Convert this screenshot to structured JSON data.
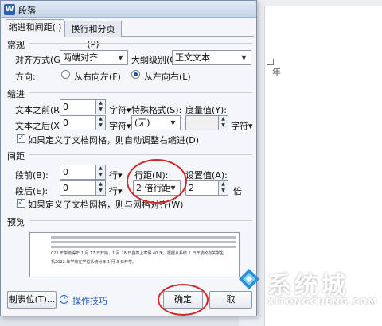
{
  "dialog": {
    "title": "段落",
    "app_icon": "W"
  },
  "tabs": [
    {
      "label": "缩进和间距(I)",
      "active": true
    },
    {
      "label": "换行和分页(P)",
      "active": false
    }
  ],
  "general": {
    "heading": "常规",
    "alignment_label": "对齐方式(G):",
    "alignment_value": "两端对齐",
    "outline_label": "大纲级别(O):",
    "outline_value": "正文文本",
    "direction_label": "方向:",
    "rtl_label": "从右向左(F)",
    "ltr_label": "从左向右(L)",
    "direction_selected": "ltr"
  },
  "indent": {
    "heading": "缩进",
    "before_label": "文本之前(R):",
    "before_value": "0",
    "before_unit": "字符▾",
    "after_label": "文本之后(X):",
    "after_value": "0",
    "after_unit": "字符▾",
    "special_label": "特殊格式(S):",
    "special_value": "(无)",
    "measure_label": "度量值(Y):",
    "measure_value": "",
    "measure_unit": "字符▾",
    "auto_adjust_label": "如果定义了文档网格，则自动调整右缩进(D)",
    "auto_adjust_checked": true
  },
  "spacing": {
    "heading": "间距",
    "before_label": "段前(B):",
    "before_value": "0",
    "before_unit": "行▾",
    "after_label": "段后(E):",
    "after_value": "0",
    "after_unit": "行▾",
    "line_label": "行距(N):",
    "line_value": "2 倍行距",
    "setting_label": "设置值(A):",
    "setting_value": "2",
    "setting_unit": "倍",
    "snap_label": "如果定义了文档网格，则与网格对齐(W)",
    "snap_checked": true
  },
  "preview": {
    "heading": "预览",
    "sample_line_1": "022 年学级得年 1 月 17 日开始，1 月 28 日自然上寒假 40 天。根据从系统 1 日开放的有关学生",
    "sample_line_2": "机2022 年学级在学位系统分年 1 月 3 日开学。"
  },
  "buttons": {
    "tabs_label": "制表位(T)...",
    "tips_label": "操作技巧",
    "ok_label": "确定",
    "cancel_label": "取"
  },
  "background": {
    "doc_corner_text": "年"
  },
  "watermark": {
    "text": "系统城",
    "sub": "XITONGCHENG.COM"
  },
  "colors": {
    "highlight_ellipse": "#d12a2a",
    "link": "#2a62b4"
  }
}
